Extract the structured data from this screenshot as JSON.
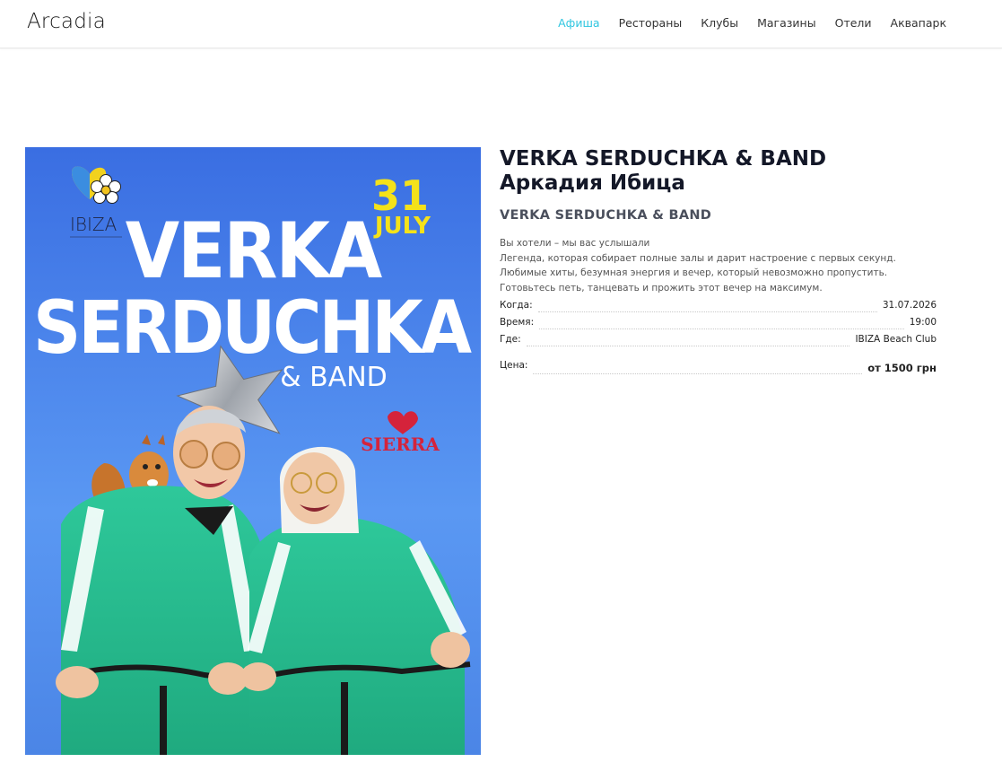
{
  "header": {
    "logo": "Arcadia",
    "nav": [
      {
        "label": "Афиша",
        "active": true
      },
      {
        "label": "Рестораны",
        "active": false
      },
      {
        "label": "Клубы",
        "active": false
      },
      {
        "label": "Магазины",
        "active": false
      },
      {
        "label": "Отели",
        "active": false
      },
      {
        "label": "Аквапарк",
        "active": false
      }
    ],
    "accent_color": "#2fc6e0"
  },
  "poster": {
    "date_day": "31",
    "date_month": "JULY",
    "headline_1": "VERKA",
    "headline_2": "SERDUCHKA",
    "headline_3": "& BAND",
    "club_logo": "IBIZA",
    "sponsor_logo": "SIERRA"
  },
  "event": {
    "title_line1": "VERKA SERDUCHKA & BAND",
    "title_line2": "Аркадия Ибица",
    "subtitle": "VERKA SERDUCHKA & BAND",
    "description": [
      "Вы хотели – мы вас услышали",
      "Легенда, которая собирает полные залы и дарит настроение с первых секунд.",
      "Любимые хиты, безумная энергия и вечер, который невозможно пропустить.",
      "Готовьтесь петь, танцевать и прожить этот вечер на максимум."
    ],
    "when_label": "Когда:",
    "when_value": "31.07.2026",
    "time_label": "Время:",
    "time_value": "19:00",
    "where_label": "Где:",
    "where_value": "IBIZA Beach Club",
    "price_label": "Цена:",
    "price_value": "от 1500 грн"
  }
}
